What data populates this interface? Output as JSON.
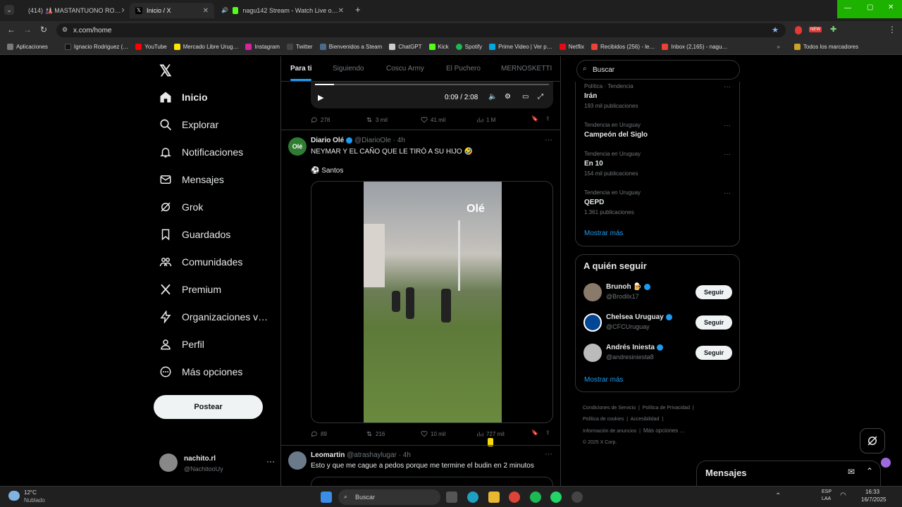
{
  "browser": {
    "tabs": [
      {
        "title": "(414) 🎎 MASTANTUONO RO…",
        "color": "#e53935"
      },
      {
        "title": "Inicio / X",
        "color": "#000000"
      },
      {
        "title": "nagu142 Stream - Watch Live o…",
        "color": "#53fc18"
      }
    ],
    "url": "x.com/home",
    "bookmarks": [
      {
        "label": "Aplicaciones",
        "color": "#7a7a7a"
      },
      {
        "label": "Ignacio Rodriguez (…",
        "color": "#111111"
      },
      {
        "label": "YouTube",
        "color": "#ff0000"
      },
      {
        "label": "Mercado Libre Urug…",
        "color": "#ffe600"
      },
      {
        "label": "Instagram",
        "color": "#d6249f"
      },
      {
        "label": "Twitter",
        "color": "#444444"
      },
      {
        "label": "Bienvenidos a Steam",
        "color": "#1b2838"
      },
      {
        "label": "ChatGPT",
        "color": "#cccccc"
      },
      {
        "label": "Kick",
        "color": "#53fc18"
      },
      {
        "label": "Spotify",
        "color": "#1db954"
      },
      {
        "label": "Prime Video | Ver p…",
        "color": "#00a8e1"
      },
      {
        "label": "Netflix",
        "color": "#e50914"
      },
      {
        "label": "Recibidos (256) - le…",
        "color": "#ea4335"
      },
      {
        "label": "Inbox (2,165) - nagu…",
        "color": "#ea4335"
      }
    ],
    "bookmarks_right": "Todos los marcadores"
  },
  "nav": {
    "items": [
      {
        "label": "Inicio",
        "icon": "home-icon"
      },
      {
        "label": "Explorar",
        "icon": "search-icon"
      },
      {
        "label": "Notificaciones",
        "icon": "bell-icon"
      },
      {
        "label": "Mensajes",
        "icon": "mail-icon"
      },
      {
        "label": "Grok",
        "icon": "grok-icon"
      },
      {
        "label": "Guardados",
        "icon": "bookmark-icon"
      },
      {
        "label": "Comunidades",
        "icon": "people-icon"
      },
      {
        "label": "Premium",
        "icon": "x-icon"
      },
      {
        "label": "Organizaciones v…",
        "icon": "bolt-icon"
      },
      {
        "label": "Perfil",
        "icon": "person-icon"
      },
      {
        "label": "Más opciones",
        "icon": "more-icon"
      }
    ],
    "post_label": "Postear",
    "user": {
      "name": "nachito.rl",
      "handle": "@NachitooUy"
    }
  },
  "feed": {
    "tabs": [
      "Para ti",
      "Siguiendo",
      "Coscu Army",
      "El Puchero",
      "MERNOSKETTI"
    ],
    "video_time": "0:09 / 2:08",
    "top_actions": {
      "replies": "278",
      "reposts": "3 mil",
      "likes": "41 mil",
      "views": "1 M"
    },
    "post": {
      "name": "Diario Olé",
      "handle": "@DiarioOle",
      "time": "· 4h",
      "text": "NEYMAR Y EL CAÑO QUE LE TIRÓ A SU HIJO 🤣",
      "sub": "⚽ Santos",
      "watermark": "Olé",
      "replies": "89",
      "reposts": "216",
      "likes": "10 mil",
      "views": "727 mil"
    },
    "post2": {
      "name": "Leomartin",
      "handle": "@atrashaylugar",
      "time": "· 4h",
      "text": "Esto y que me cague a pedos porque me termine el budin en 2 minutos"
    }
  },
  "right": {
    "search_placeholder": "Buscar",
    "trends": [
      {
        "context": "Política · Tendencia",
        "title": "Irán",
        "count": "193 mil publicaciones"
      },
      {
        "context": "Tendencia en Uruguay",
        "title": "Campeón del Siglo",
        "count": ""
      },
      {
        "context": "Tendencia en Uruguay",
        "title": "En 10",
        "count": "154 mil publicaciones"
      },
      {
        "context": "Tendencia en Uruguay",
        "title": "QEPD",
        "count": "1.361 publicaciones"
      }
    ],
    "show_more": "Mostrar más",
    "follow_title": "A quién seguir",
    "follow": [
      {
        "name": "Brunoh 🍺",
        "handle": "@Brodilx17"
      },
      {
        "name": "Chelsea Uruguay",
        "handle": "@CFCUruguay"
      },
      {
        "name": "Andrés Iniesta",
        "handle": "@andresiniesta8"
      }
    ],
    "follow_label": "Seguir",
    "footer": [
      "Condiciones de Servicio",
      "Política de Privacidad",
      "Política de cookies",
      "Accesibilidad",
      "Información de anuncios",
      "Más opciones …",
      "© 2025 X Corp."
    ],
    "messages_label": "Mensajes"
  },
  "taskbar": {
    "weather_temp": "12°C",
    "weather_desc": "Nublado",
    "search": "Buscar",
    "lang1": "ESP",
    "lang2": "LAA",
    "time": "16:33",
    "date": "16/7/2025"
  }
}
